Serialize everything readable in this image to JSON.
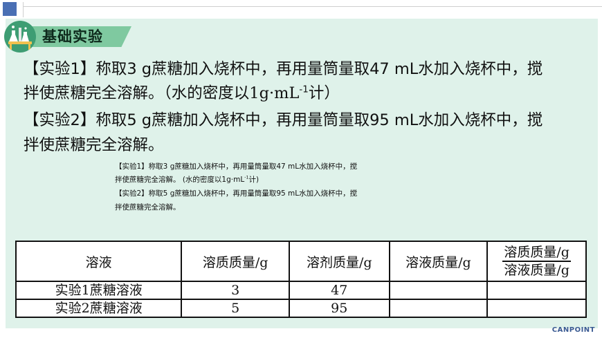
{
  "section": {
    "title": "基础实验",
    "icon": "chemistry-flasks-icon"
  },
  "paragraphs": {
    "exp1_line1": "【实验1】称取3 g蔗糖加入烧杯中，再用量筒量取47 mL水加入烧杯中，搅",
    "exp1_line2_main": "拌使蔗糖完全溶解。（水的密度以",
    "exp1_density_value": "1g·mL",
    "exp1_density_exp": "-1",
    "exp1_density_end": "计）",
    "exp2_line1": "【实验2】称取5 g蔗糖加入烧杯中，再用量筒量取95 mL水加入烧杯中，搅",
    "exp2_line2": "拌使蔗糖完全溶解。"
  },
  "small_text": {
    "line1": "【实验1】称取3 g蔗糖加入烧杯中，再用量筒量取47 mL水加入烧杯中，搅",
    "line2_main": "拌使蔗糖完全溶解。  (水的密度以1g·mL",
    "line2_exp": "-1",
    "line2_end": "计)",
    "line3": "【实验2】称取5 g蔗糖加入烧杯中，再用量筒量取95 mL水加入烧杯中，搅",
    "line4": "拌使蔗糖完全溶解。"
  },
  "table": {
    "headers": {
      "solution": "溶液",
      "solute_mass": "溶质质量/g",
      "solvent_mass": "溶剂质量/g",
      "solution_mass": "溶液质量/g",
      "ratio_numerator": "溶质质量/g",
      "ratio_denominator": "溶液质量/g"
    },
    "rows": [
      {
        "name": "实验1蔗糖溶液",
        "solute": "3",
        "solvent": "47",
        "solution": "",
        "ratio": ""
      },
      {
        "name": "实验2蔗糖溶液",
        "solute": "5",
        "solvent": "95",
        "solution": "",
        "ratio": ""
      }
    ]
  },
  "brand": {
    "logo_text": "CANPOINT"
  },
  "colors": {
    "panel_bg": "#dff2ea",
    "banner": "#7fc9a0",
    "icon_bg": "#3e9d73",
    "corner": "#4a6fb4"
  }
}
